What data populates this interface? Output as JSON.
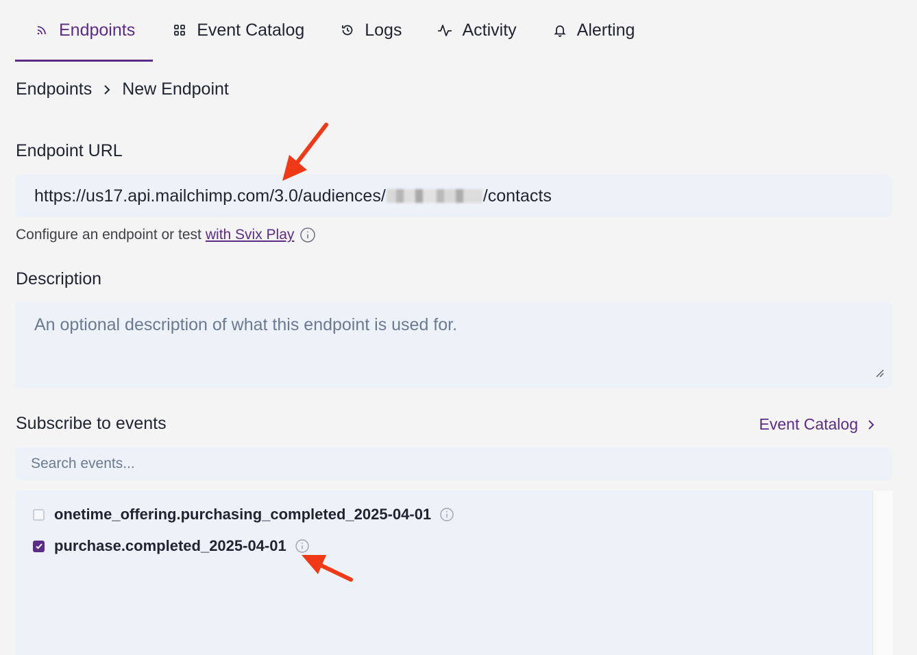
{
  "tabs": [
    {
      "label": "Endpoints",
      "icon": "rss-icon",
      "active": true
    },
    {
      "label": "Event Catalog",
      "icon": "grid-icon",
      "active": false
    },
    {
      "label": "Logs",
      "icon": "history-icon",
      "active": false
    },
    {
      "label": "Activity",
      "icon": "activity-icon",
      "active": false
    },
    {
      "label": "Alerting",
      "icon": "bell-icon",
      "active": false
    }
  ],
  "breadcrumb": {
    "parent": "Endpoints",
    "current": "New Endpoint"
  },
  "form": {
    "url_label": "Endpoint URL",
    "url_value_prefix": "https://us17.api.mailchimp.com/3.0/audiences/",
    "url_value_suffix": "/contacts",
    "url_help_text": "Configure an endpoint or test",
    "url_help_link": "with Svix Play",
    "description_label": "Description",
    "description_placeholder": "An optional description of what this endpoint is used for.",
    "subscribe_label": "Subscribe to events",
    "event_catalog_link": "Event Catalog",
    "search_placeholder": "Search events..."
  },
  "events": [
    {
      "name": "onetime_offering.purchasing_completed_2025-04-01",
      "checked": false
    },
    {
      "name": "purchase.completed_2025-04-01",
      "checked": true
    }
  ],
  "colors": {
    "accent": "#5b2c86",
    "annotation_arrow": "#f03a17",
    "field_bg": "#edf1f8"
  }
}
